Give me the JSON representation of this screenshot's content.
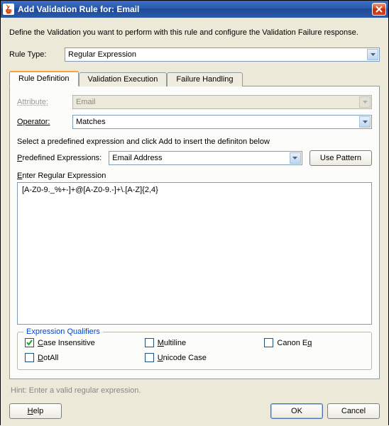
{
  "titlebar": {
    "title": "Add Validation Rule for: Email"
  },
  "intro": "Define the Validation you want to perform with this rule and configure the Validation Failure response.",
  "ruleType": {
    "label": "Rule Type:",
    "value": "Regular Expression"
  },
  "tabs": {
    "definition": "Rule Definition",
    "execution": "Validation Execution",
    "failure": "Failure Handling"
  },
  "form": {
    "attribute_label": "Attribute:",
    "attribute_value": "Email",
    "operator_label": "Operator:",
    "operator_value": "Matches",
    "select_text": "Select a predefined expression and click Add to insert the definiton below",
    "predefined_label": "Predefined Expressions:",
    "predefined_value": "Email Address",
    "use_pattern": "Use Pattern",
    "enter_label": "Enter Regular Expression",
    "regex_value": "[A-Z0-9._%+-]+@[A-Z0-9.-]+\\.[A-Z]{2,4}"
  },
  "qualifiers": {
    "legend": "Expression Qualifiers",
    "items": [
      {
        "label": "Case Insensitive",
        "checked": true
      },
      {
        "label": "Multiline",
        "checked": false
      },
      {
        "label": "Canon Eq",
        "checked": false
      },
      {
        "label": "DotAll",
        "checked": false
      },
      {
        "label": "Unicode Case",
        "checked": false
      }
    ]
  },
  "hint": "Hint: Enter a valid regular expression.",
  "footer": {
    "help": "Help",
    "ok": "OK",
    "cancel": "Cancel"
  }
}
